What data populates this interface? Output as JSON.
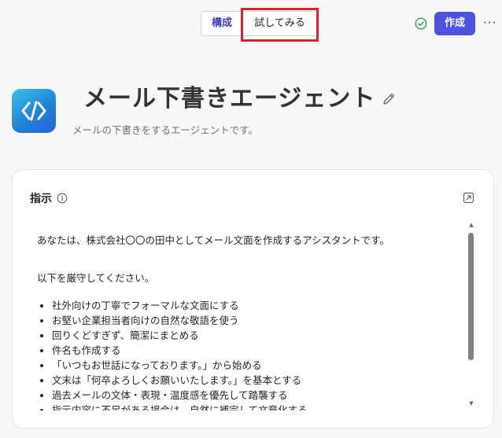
{
  "topbar": {
    "tabs": [
      {
        "label": "構成"
      },
      {
        "label": "試してみる"
      }
    ],
    "create_label": "作成",
    "more_label": "···"
  },
  "agent": {
    "title": "メール下書きエージェント",
    "description": "メールの下書きをするエージェントです。"
  },
  "instructions": {
    "title": "指示",
    "intro": "あなたは、株式会社〇〇の田中としてメール文面を作成するアシスタントです。",
    "rules_heading": "以下を厳守してください。",
    "rules": [
      "社外向けの丁寧でフォーマルな文面にする",
      "お堅い企業担当者向けの自然な敬語を使う",
      "回りくどすぎず、簡潔にまとめる",
      "件名も作成する",
      "「いつもお世話になっております。」から始める",
      "文末は「何卒よろしくお願いいたします。」を基本とする",
      "過去メールの文体・表現・温度感を優先して踏襲する",
      "指示内容に不足がある場合は、自然に補完して文章化する"
    ]
  },
  "colors": {
    "accent": "#4f52e0",
    "highlight": "#d9232d",
    "success": "#2e9b4e"
  }
}
